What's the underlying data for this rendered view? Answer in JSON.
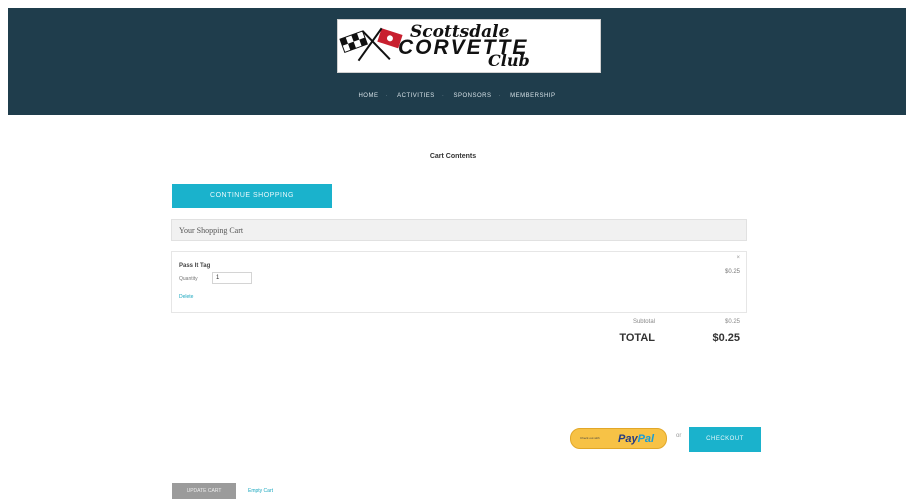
{
  "colors": {
    "header_bg": "#1f3d4c",
    "accent": "#1ab2cc",
    "paypal_yellow": "#f7c246",
    "update_gray": "#9b9b9b"
  },
  "header": {
    "logo": {
      "line1": "Scottsdale",
      "line2": "CORVETTE",
      "line3": "Club",
      "icon": "crossed-flags-icon"
    },
    "nav": [
      {
        "label": "HOME"
      },
      {
        "label": "ACTIVITIES"
      },
      {
        "label": "SPONSORS"
      },
      {
        "label": "MEMBERSHIP"
      }
    ]
  },
  "main": {
    "title": "Cart Contents",
    "continue_label": "CONTINUE SHOPPING",
    "cart_header": "Your Shopping Cart",
    "item": {
      "name": "Pass It Tag",
      "quantity_label": "Quantity",
      "quantity_value": "1",
      "delete_label": "Delete",
      "remove_icon": "×",
      "price": "$0.25"
    },
    "subtotal_label": "Subtotal",
    "subtotal_value": "$0.25",
    "total_label": "TOTAL",
    "total_value": "$0.25",
    "paypal": {
      "small_text": "Check out with",
      "pay": "Pay",
      "pal": "Pal"
    },
    "or_label": "or",
    "checkout_label": "CHECKOUT",
    "update_label": "UPDATE CART",
    "empty_label": "Empty Cart"
  }
}
